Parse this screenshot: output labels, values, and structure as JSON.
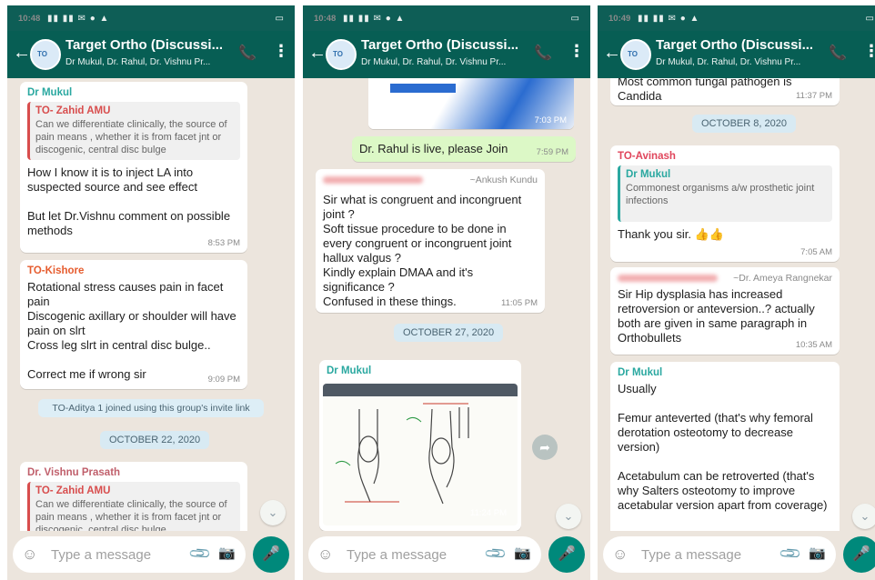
{
  "status": {
    "times": [
      "10:48",
      "10:48",
      "10:49"
    ]
  },
  "header": {
    "title": "Target Ortho (Discussi...",
    "subtitle": "Dr Mukul, Dr. Rahul, Dr. Vishnu Pr..."
  },
  "input": {
    "placeholder": "Type a message"
  },
  "screen1": {
    "m1": {
      "sender": "Dr Mukul",
      "quote_sender": "TO- Zahid AMU",
      "quote_text": "Can we differentiate clinically, the source of pain means , whether it is from facet jnt or discogenic, central disc bulge",
      "text": "How I know it is to inject LA into suspected source and see effect\n\nBut let Dr.Vishnu comment on possible methods",
      "time": "8:53 PM"
    },
    "m2": {
      "sender": "TO-Kishore",
      "text": "Rotational stress causes pain  in facet pain\nDiscogenic axillary or shoulder will have pain on slrt\nCross leg slrt in central disc bulge..\n\nCorrect me if wrong sir",
      "time": "9:09 PM"
    },
    "join": "TO-Aditya 1 joined using this group's invite link",
    "date": "OCTOBER 22, 2020",
    "m3": {
      "sender": "Dr. Vishnu Prasath",
      "quote_sender": "TO- Zahid AMU",
      "quote_text": "Can we differentiate clinically, the source of pain means , whether it is from facet jnt or discogenic, central disc bulge"
    }
  },
  "screen2": {
    "img_time": "7:03 PM",
    "out": {
      "text": "Dr. Rahul is live, please Join",
      "time": "7:59 PM"
    },
    "m1": {
      "by": "~Ankush Kundu",
      "text": "Sir what is congruent and incongruent joint ?\nSoft tissue procedure to be done in every congruent or incongruent joint hallux valgus ?\nKindly explain DMAA and it's significance ?\nConfused in these things.",
      "time": "11:05 PM"
    },
    "date": "OCTOBER 27, 2020",
    "m2": {
      "sender": "Dr Mukul",
      "time": "11:24 PM"
    }
  },
  "screen3": {
    "m0": {
      "text": "Most common fungal pathogen is Candida",
      "time": "11:37 PM"
    },
    "date": "OCTOBER 8, 2020",
    "m1": {
      "sender": "TO-Avinash",
      "quote_sender": "Dr Mukul",
      "quote_text": "Commonest organisms a/w prosthetic joint infections",
      "text": "Thank you sir. 👍👍",
      "time": "7:05 AM"
    },
    "m2": {
      "by": "~Dr. Ameya Rangnekar",
      "text": "Sir Hip dysplasia has increased retroversion or anteversion..? actually both are given in same paragraph in Orthobullets",
      "time": "10:35 AM"
    },
    "m3": {
      "sender": "Dr Mukul",
      "text": "Usually\n\nFemur anteverted (that's why femoral derotation osteotomy to decrease version)\n\nAcetabulum can be retroverted (that's why Salters osteotomy to improve acetabular version apart from coverage)"
    }
  },
  "colors": {
    "header": "#075e54",
    "status": "#0e5e56",
    "wallpaper": "#ece5dd",
    "outgoing": "#dcf8c6",
    "mukul": "#2aa8a0",
    "zahid": "#d84d4d",
    "kishore": "#e65c2e",
    "vishnu": "#c05f6b",
    "avinash": "#e0455b",
    "mic": "#00897b"
  }
}
